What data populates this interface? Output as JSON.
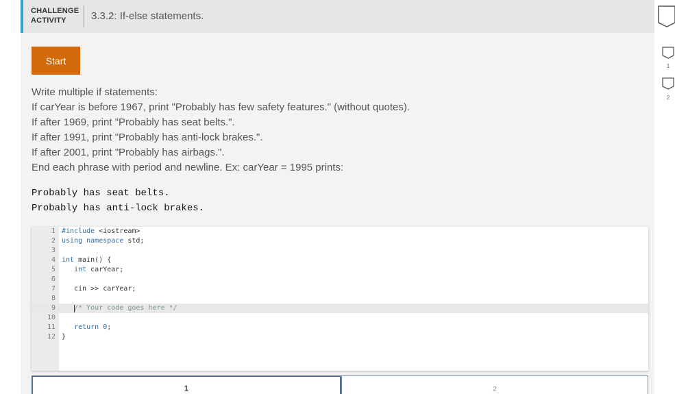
{
  "header": {
    "tag_line1": "CHALLENGE",
    "tag_line2": "ACTIVITY",
    "title": "3.3.2: If-else statements."
  },
  "start_button": {
    "label": "Start"
  },
  "instructions": [
    "Write multiple if statements:",
    "If carYear is before 1967, print \"Probably has few safety features.\" (without quotes).",
    "If after 1969, print \"Probably has seat belts.\".",
    "If after 1991, print \"Probably has anti-lock brakes.\".",
    "If after 2001, print \"Probably has airbags.\".",
    "End each phrase with period and newline. Ex: carYear = 1995 prints:"
  ],
  "expected_output": [
    "Probably has seat belts.",
    "Probably has anti-lock brakes."
  ],
  "editor": {
    "active_line": 9,
    "lines": [
      {
        "n": "1",
        "text": "#include <iostream>"
      },
      {
        "n": "2",
        "text": "using namespace std;"
      },
      {
        "n": "3",
        "text": ""
      },
      {
        "n": "4",
        "text": "int main() {"
      },
      {
        "n": "5",
        "text": "   int carYear;"
      },
      {
        "n": "6",
        "text": ""
      },
      {
        "n": "7",
        "text": "   cin >> carYear;"
      },
      {
        "n": "8",
        "text": ""
      },
      {
        "n": "9",
        "text": "   /* Your code goes here */"
      },
      {
        "n": "10",
        "text": ""
      },
      {
        "n": "11",
        "text": "   return 0;"
      },
      {
        "n": "12",
        "text": "}"
      }
    ]
  },
  "tabs": [
    {
      "label": "1",
      "active": true
    },
    {
      "label": "2",
      "active": false
    }
  ],
  "side_markers": [
    {
      "label": "1"
    },
    {
      "label": "2"
    }
  ],
  "colors": {
    "accent": "#2e9fd8",
    "start_button": "#d26a0c"
  }
}
